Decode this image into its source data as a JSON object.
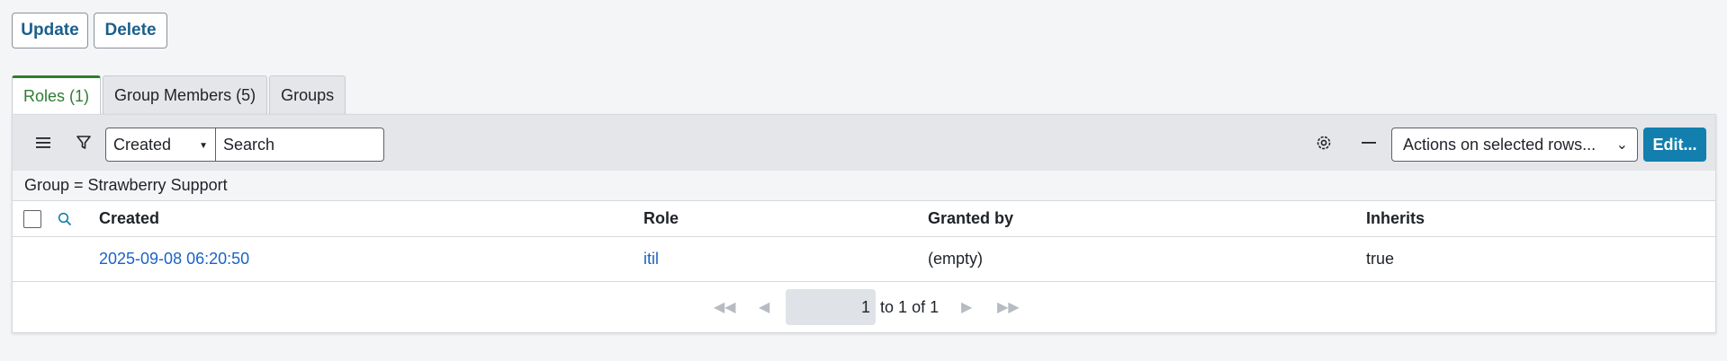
{
  "actions": {
    "update_label": "Update",
    "delete_label": "Delete"
  },
  "tabs": [
    {
      "label": "Roles (1)",
      "active": true
    },
    {
      "label": "Group Members (5)",
      "active": false
    },
    {
      "label": "Groups",
      "active": false
    }
  ],
  "toolbar": {
    "field_select": "Created",
    "search_placeholder": "Search",
    "actions_select": "Actions on selected rows...",
    "edit_label": "Edit..."
  },
  "breadcrumb": "Group = Strawberry Support",
  "table": {
    "columns": [
      "Created",
      "Role",
      "Granted by",
      "Inherits"
    ],
    "rows": [
      {
        "created": "2025-09-08 06:20:50",
        "role": "itil",
        "granted_by": "(empty)",
        "inherits": "true"
      }
    ]
  },
  "pagination": {
    "current": "1",
    "to_label": "to",
    "to_value": "1",
    "of_label": "of",
    "total": "1"
  },
  "colors": {
    "accent": "#137fae",
    "active_tab": "#2f7d32",
    "link": "#1b63c6"
  }
}
